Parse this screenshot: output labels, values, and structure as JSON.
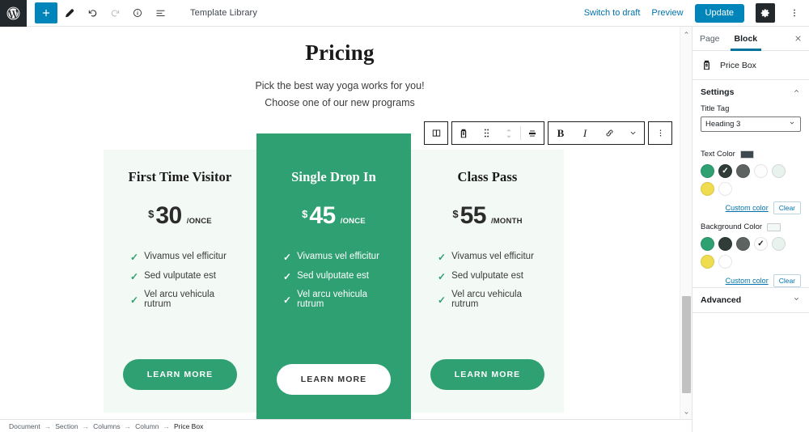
{
  "topbar": {
    "logo_icon": "wordpress-logo-icon",
    "left_tools": [
      {
        "name": "add-block-button",
        "icon": "plus-icon",
        "state": "primary"
      },
      {
        "name": "edit-mode-button",
        "icon": "pencil-icon",
        "state": "default"
      },
      {
        "name": "undo-button",
        "icon": "undo-arrow-icon",
        "state": "default"
      },
      {
        "name": "redo-button",
        "icon": "redo-arrow-icon",
        "state": "disabled"
      },
      {
        "name": "content-info-button",
        "icon": "info-circle-icon",
        "state": "default"
      },
      {
        "name": "block-navigation-button",
        "icon": "list-view-icon",
        "state": "default"
      }
    ],
    "template_library_label": "Template Library",
    "switch_to_draft_label": "Switch to draft",
    "preview_label": "Preview",
    "update_label": "Update",
    "settings_gear_icon": "gear-icon",
    "more_menu_icon": "kebab-vertical-icon"
  },
  "canvas": {
    "title": "Pricing",
    "subtitle_line1": "Pick the best way yoga works for you!",
    "subtitle_line2": "Choose one of our new programs",
    "block_toolbar": {
      "items": [
        {
          "name": "toolbar-select-parent-button",
          "icon": "columns-block-icon"
        },
        {
          "name": "toolbar-block-type-button",
          "icon": "price-box-icon"
        },
        {
          "name": "toolbar-drag-handle",
          "icon": "drag-dots-icon"
        },
        {
          "name": "toolbar-move-updown-button",
          "icon": "chevron-up-down-icon"
        },
        {
          "name": "toolbar-align-button",
          "icon": "align-center-icon"
        },
        {
          "name": "toolbar-bold-button",
          "icon": "bold-icon",
          "glyph": "B"
        },
        {
          "name": "toolbar-italic-button",
          "icon": "italic-icon",
          "glyph": "I"
        },
        {
          "name": "toolbar-link-button",
          "icon": "link-icon"
        },
        {
          "name": "toolbar-more-rich-text-button",
          "icon": "chevron-down-icon"
        },
        {
          "name": "toolbar-block-options-button",
          "icon": "kebab-vertical-icon"
        }
      ]
    },
    "cards": [
      {
        "title": "First Time Visitor",
        "currency": "$",
        "amount": "30",
        "period": "/ONCE",
        "features": [
          "Vivamus vel efficitur",
          "Sed vulputate est",
          "Vel arcu vehicula rutrum"
        ],
        "button_label": "LEARN MORE",
        "highlighted": false
      },
      {
        "title": "Single Drop In",
        "currency": "$",
        "amount": "45",
        "period": "/ONCE",
        "features": [
          "Vivamus vel efficitur",
          "Sed vulputate est",
          "Vel arcu vehicula rutrum"
        ],
        "button_label": "LEARN MORE",
        "highlighted": true
      },
      {
        "title": "Class Pass",
        "currency": "$",
        "amount": "55",
        "period": "/MONTH",
        "features": [
          "Vivamus vel efficitur",
          "Sed vulputate est",
          "Vel arcu vehicula rutrum"
        ],
        "button_label": "LEARN MORE",
        "highlighted": false
      }
    ],
    "check_glyph": "✓",
    "appender_icon": "plus-icon",
    "scrollbar": {
      "up_icon": "chevron-up-icon",
      "down_icon": "chevron-down-icon"
    }
  },
  "sidebar": {
    "tabs": [
      {
        "label": "Page",
        "active": false
      },
      {
        "label": "Block",
        "active": true
      }
    ],
    "close_icon": "close-x-icon",
    "block": {
      "name": "Price Box",
      "icon": "price-box-icon"
    },
    "settings_panel": {
      "label": "Settings",
      "collapse_icon": "chevron-up-icon",
      "title_tag": {
        "label": "Title Tag",
        "value": "Heading 3",
        "chevron_icon": "chevron-down-icon"
      },
      "text_color": {
        "label": "Text Color",
        "current_swatch": "#3d484f",
        "swatches": [
          {
            "hex": "#2fa071",
            "selected": false
          },
          {
            "hex": "#2f3c38",
            "selected": true
          },
          {
            "hex": "#5d6360",
            "selected": false
          },
          {
            "hex": "#fdfdfd",
            "selected": false
          },
          {
            "hex": "#e9f2ec",
            "selected": false
          },
          {
            "hex": "#f0dd4f",
            "selected": false
          },
          {
            "hex": "#ffffff",
            "selected": false
          }
        ],
        "custom_color_label": "Custom color",
        "clear_label": "Clear"
      },
      "background_color": {
        "label": "Background Color",
        "current_swatch": "#f3f9f6",
        "swatches": [
          {
            "hex": "#2fa071",
            "selected": false
          },
          {
            "hex": "#2f3c38",
            "selected": false
          },
          {
            "hex": "#5d6360",
            "selected": false
          },
          {
            "hex": "#fdfdfd",
            "selected": true
          },
          {
            "hex": "#e9f2ec",
            "selected": false
          },
          {
            "hex": "#f0dd4f",
            "selected": false
          },
          {
            "hex": "#ffffff",
            "selected": false
          }
        ],
        "custom_color_label": "Custom color",
        "clear_label": "Clear"
      }
    },
    "advanced_panel": {
      "label": "Advanced",
      "expand_icon": "chevron-down-icon"
    }
  },
  "breadcrumb": {
    "separator": "→",
    "items": [
      "Document",
      "Section",
      "Columns",
      "Column",
      "Price Box"
    ]
  }
}
